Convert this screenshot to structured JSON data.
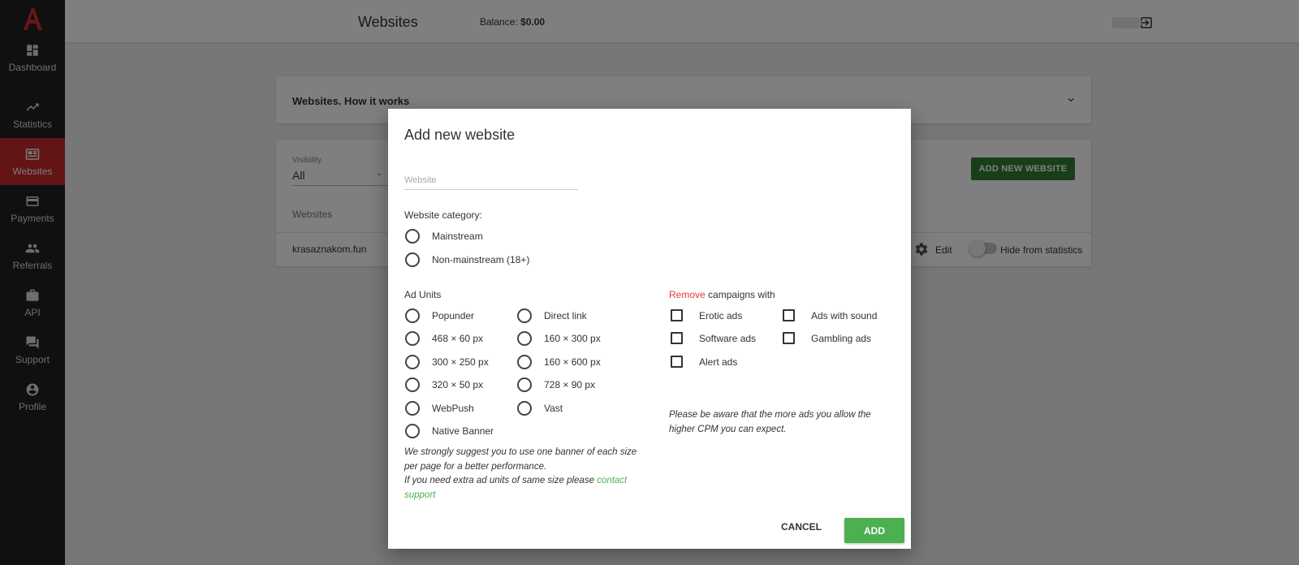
{
  "sidebar": {
    "logo": "A",
    "items": [
      {
        "label": "Dashboard",
        "icon": "dashboard-icon"
      },
      {
        "label": "Statistics",
        "icon": "trending-up-icon"
      },
      {
        "label": "Websites",
        "icon": "websites-icon",
        "active": true
      },
      {
        "label": "Payments",
        "icon": "credit-card-icon"
      },
      {
        "label": "Referrals",
        "icon": "people-icon"
      },
      {
        "label": "API",
        "icon": "briefcase-icon"
      },
      {
        "label": "Support",
        "icon": "chat-icon"
      },
      {
        "label": "Profile",
        "icon": "account-circle-icon"
      }
    ]
  },
  "header": {
    "title": "Websites",
    "balance_label": "Balance:",
    "balance_value": "$0.00"
  },
  "how_it_works": {
    "title": "Websites. How it works"
  },
  "websites_card": {
    "visibility_label": "Visibility",
    "visibility_value": "All",
    "add_button": "ADD NEW WEBSITE",
    "column_header": "Websites",
    "row": {
      "site": "krasaznakom.fun",
      "edit_label": "Edit",
      "hide_label": "Hide from statistics"
    }
  },
  "modal": {
    "title": "Add new website",
    "website_placeholder": "Website",
    "website_value": "",
    "category_label": "Website category:",
    "categories": [
      "Mainstream",
      "Non-mainstream (18+)"
    ],
    "ad_units_label": "Ad Units",
    "ad_units_col1": [
      "Popunder",
      "468 × 60 px",
      "300 × 250 px",
      "320 × 50 px",
      "WebPush",
      "Native Banner"
    ],
    "ad_units_col2": [
      "Direct link",
      "160 × 300 px",
      "160 × 600 px",
      "728 × 90 px",
      "Vast"
    ],
    "ad_units_note_line1": "We strongly suggest you to use one banner of each size per page for a better performance.",
    "ad_units_note_line2": "If you need extra ad units of same size please ",
    "contact_link": "contact support",
    "remove_word": "Remove",
    "remove_rest": " campaigns with",
    "remove_col1": [
      "Erotic ads",
      "Software ads",
      "Alert ads"
    ],
    "remove_col2": [
      "Ads with sound",
      "Gambling ads"
    ],
    "remove_note": "Please be aware that the more ads you allow the higher CPM you can expect.",
    "cancel_label": "CANCEL",
    "add_label": "ADD"
  },
  "colors": {
    "sidebar_bg": "#212121",
    "active_red": "#c62828",
    "green_button": "#4caf50",
    "dark_green_button": "#2e7d32",
    "remove_red": "#e53935"
  }
}
